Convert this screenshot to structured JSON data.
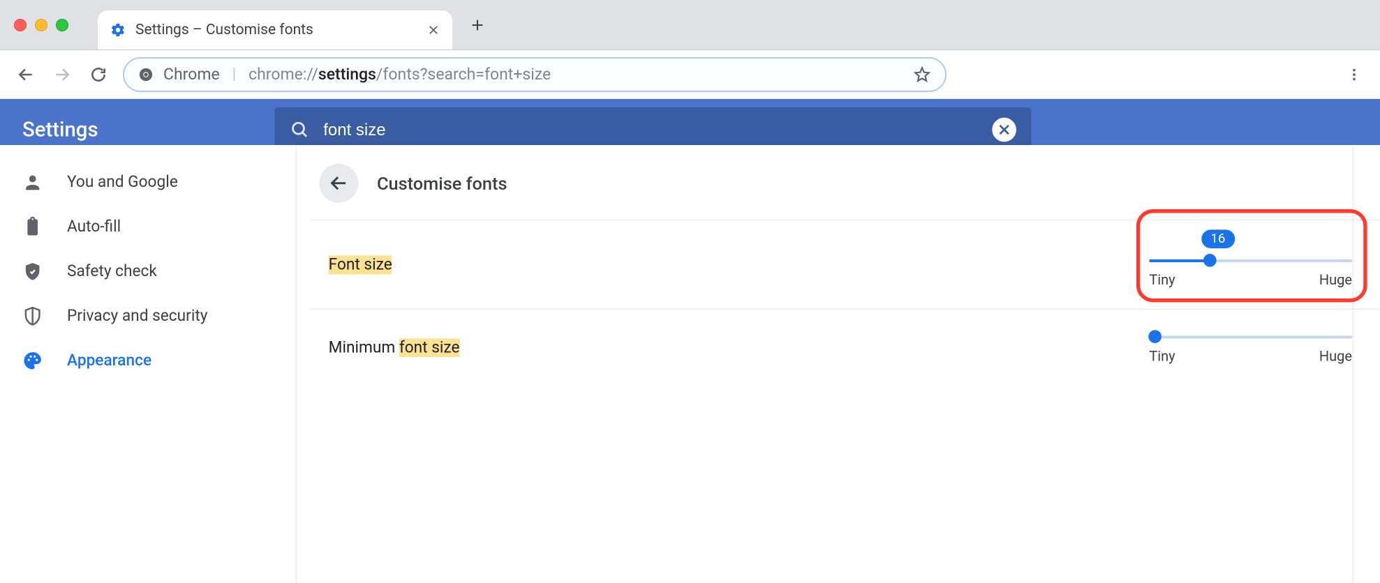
{
  "browser": {
    "tab_title": "Settings – Customise fonts",
    "url_scheme_label": "Chrome",
    "url_prefix": "chrome://",
    "url_bold": "settings",
    "url_rest": "/fonts?search=font+size"
  },
  "appbar": {
    "title": "Settings",
    "search_value": "font size"
  },
  "sidebar": {
    "items": [
      {
        "label": "You and Google"
      },
      {
        "label": "Auto-fill"
      },
      {
        "label": "Safety check"
      },
      {
        "label": "Privacy and security"
      },
      {
        "label": "Appearance"
      }
    ]
  },
  "panel": {
    "title": "Customise fonts",
    "rows": {
      "font_size": {
        "label_hl": "Font size",
        "value": "16",
        "min_label": "Tiny",
        "max_label": "Huge",
        "fill_pct": 30
      },
      "min_font_size": {
        "label_plain": "Minimum ",
        "label_hl": "font size",
        "min_label": "Tiny",
        "max_label": "Huge",
        "fill_pct": 3
      }
    }
  },
  "colors": {
    "annotation": "#ff3b30"
  }
}
